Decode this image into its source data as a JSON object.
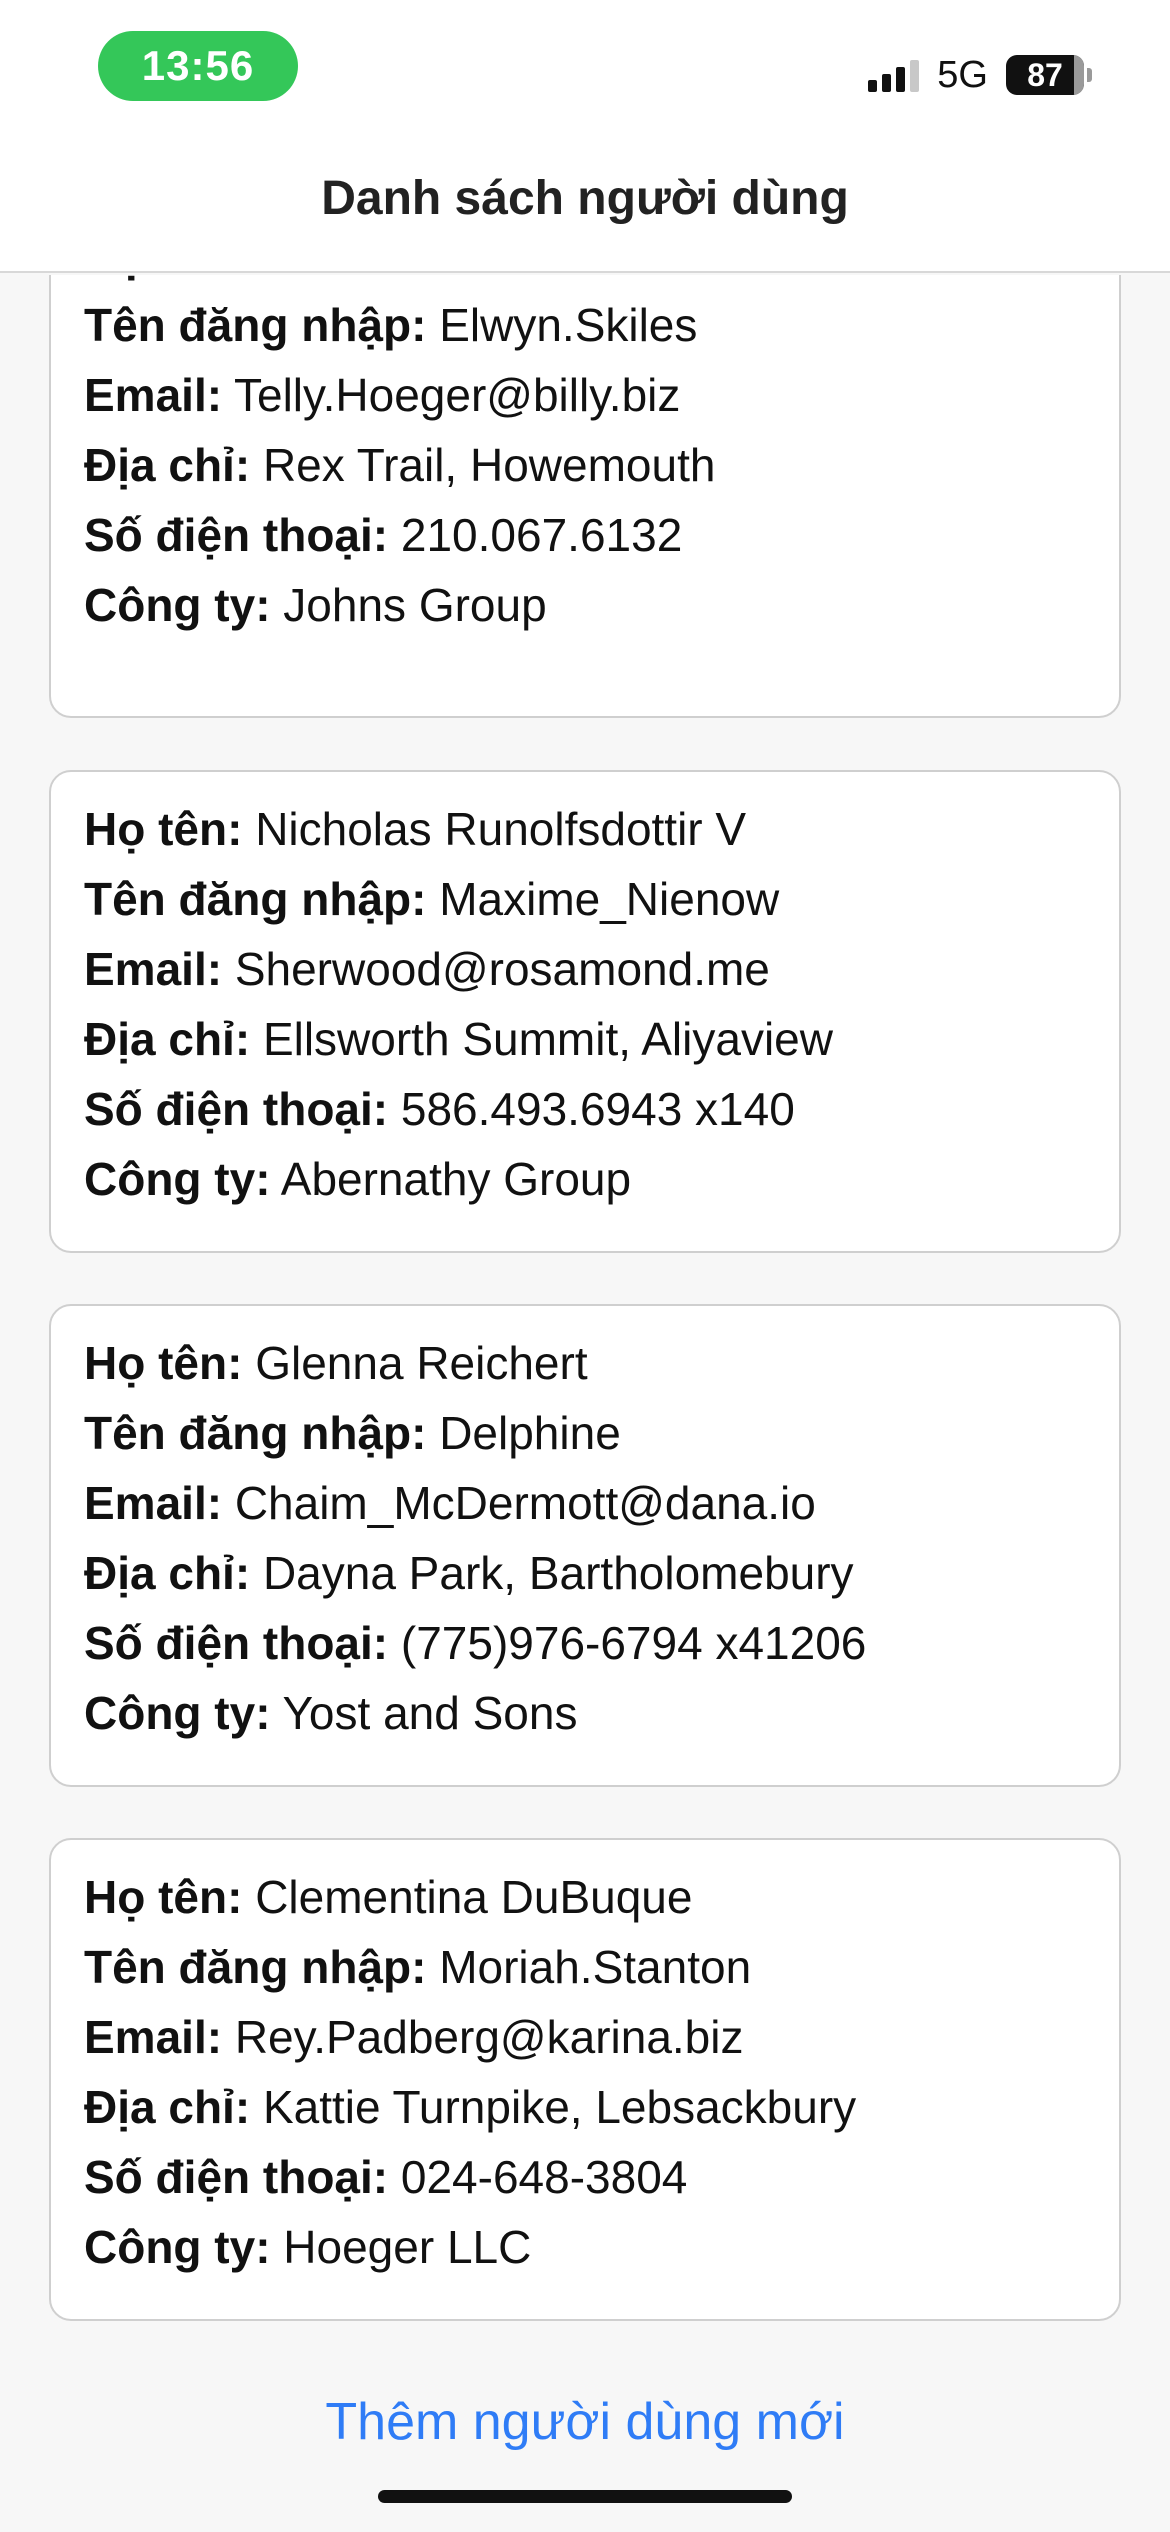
{
  "status_bar": {
    "time": "13:56",
    "network": "5G",
    "battery": "87"
  },
  "header": {
    "title": "Danh sách người dùng"
  },
  "labels": {
    "name": "Họ tên:",
    "username": "Tên đăng nhập:",
    "email": "Email:",
    "address": "Địa chỉ:",
    "phone": "Số điện thoại:",
    "company": "Công ty:"
  },
  "users": [
    {
      "name": "",
      "username": "Elwyn.Skiles",
      "email": "Telly.Hoeger@billy.biz",
      "address": "Rex Trail, Howemouth",
      "phone": "210.067.6132",
      "company": "Johns Group"
    },
    {
      "name": "Nicholas Runolfsdottir V",
      "username": "Maxime_Nienow",
      "email": "Sherwood@rosamond.me",
      "address": "Ellsworth Summit, Aliyaview",
      "phone": "586.493.6943 x140",
      "company": "Abernathy Group"
    },
    {
      "name": "Glenna Reichert",
      "username": "Delphine",
      "email": "Chaim_McDermott@dana.io",
      "address": "Dayna Park, Bartholomebury",
      "phone": "(775)976-6794 x41206",
      "company": "Yost and Sons"
    },
    {
      "name": "Clementina DuBuque",
      "username": "Moriah.Stanton",
      "email": "Rey.Padberg@karina.biz",
      "address": "Kattie Turnpike, Lebsackbury",
      "phone": "024-648-3804",
      "company": "Hoeger LLC"
    }
  ],
  "footer": {
    "add_user": "Thêm người dùng mới"
  }
}
